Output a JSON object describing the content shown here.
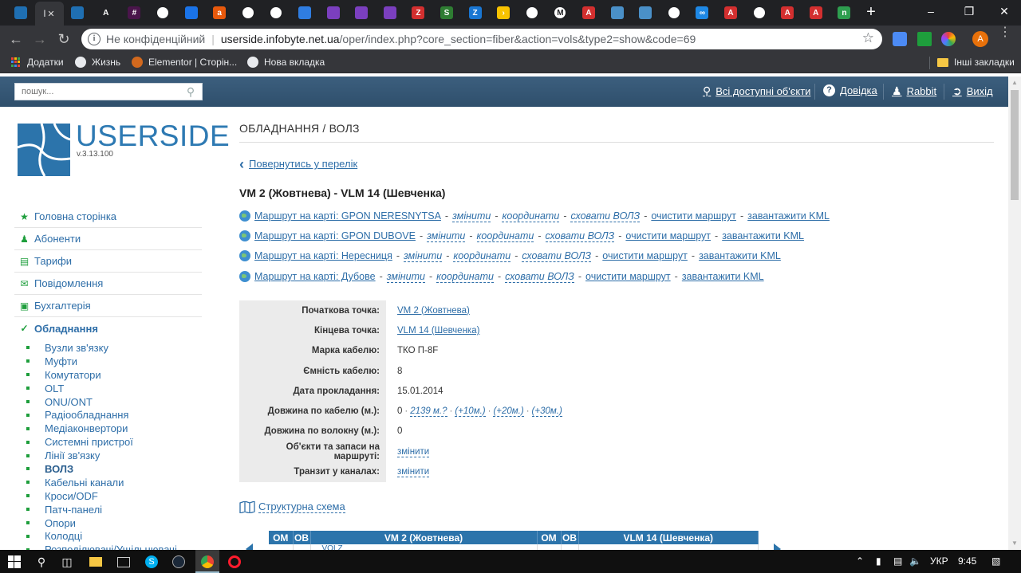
{
  "browser": {
    "tabs": [
      {
        "icon": "userside-favicon",
        "color": "#1f6fb2",
        "letter": ""
      },
      {
        "icon": "userside-favicon",
        "color": "#1f6fb2",
        "letter": ""
      },
      {
        "icon": "userside-favicon",
        "color": "#1f6fb2",
        "letter": ""
      },
      {
        "icon": "type-a-favicon",
        "color": "#202124",
        "letter": "A"
      },
      {
        "icon": "slack-favicon",
        "color": "#4a154b",
        "letter": "#"
      },
      {
        "icon": "square-favicon",
        "color": "#ffffff",
        "letter": ""
      },
      {
        "icon": "runner-favicon",
        "color": "#1a73e8",
        "letter": ""
      },
      {
        "icon": "orange-favicon",
        "color": "#e8590c",
        "letter": "a"
      },
      {
        "icon": "globe-favicon",
        "color": "#ffffff",
        "letter": ""
      },
      {
        "icon": "globe-favicon",
        "color": "#ffffff",
        "letter": ""
      },
      {
        "icon": "web-favicon",
        "color": "#2f7de1",
        "letter": ""
      },
      {
        "icon": "purple-favicon",
        "color": "#7b3fbf",
        "letter": ""
      },
      {
        "icon": "purple-favicon",
        "color": "#7b3fbf",
        "letter": ""
      },
      {
        "icon": "purple-favicon",
        "color": "#7b3fbf",
        "letter": ""
      },
      {
        "icon": "z-red-favicon",
        "color": "#d32f2f",
        "letter": "Z"
      },
      {
        "icon": "s-green-favicon",
        "color": "#2e7d32",
        "letter": "S"
      },
      {
        "icon": "z-blue-favicon",
        "color": "#1976d2",
        "letter": "Z"
      },
      {
        "icon": "arrow-yellow-favicon",
        "color": "#f9c300",
        "letter": "›"
      },
      {
        "icon": "circle-favicon",
        "color": "#ffffff",
        "letter": ""
      },
      {
        "icon": "gmail-favicon",
        "color": "#ffffff",
        "letter": "M"
      },
      {
        "icon": "a-red-favicon",
        "color": "#d32f2f",
        "letter": "A"
      },
      {
        "icon": "router-favicon",
        "color": "#4a90c8",
        "letter": ""
      },
      {
        "icon": "router-favicon",
        "color": "#4a90c8",
        "letter": ""
      },
      {
        "icon": "globe-favicon",
        "color": "#ffffff",
        "letter": ""
      },
      {
        "icon": "infinity-favicon",
        "color": "#1e88e5",
        "letter": "∞"
      },
      {
        "icon": "a-red-favicon",
        "color": "#d32f2f",
        "letter": "A"
      },
      {
        "icon": "doc-favicon",
        "color": "#ffffff",
        "letter": ""
      },
      {
        "icon": "a-red-favicon",
        "color": "#d32f2f",
        "letter": "A"
      },
      {
        "icon": "a-red-favicon",
        "color": "#d32f2f",
        "letter": "A"
      },
      {
        "icon": "n-green-favicon",
        "color": "#2e9e4f",
        "letter": "n"
      }
    ],
    "active_tab_label": "l",
    "address": {
      "security_label": "Не конфіденційний",
      "host": "userside.infobyte.net.ua",
      "path": "/oper/index.php?core_section=fiber&action=vols&type2=show&code=69"
    },
    "profile_letter": "A",
    "bookmarks": [
      {
        "label": "Додатки",
        "icon": "apps-icon"
      },
      {
        "label": "Жизнь",
        "icon": "globe-icon"
      },
      {
        "label": "Elementor | Сторін...",
        "icon": "elementor-icon"
      },
      {
        "label": "Нова вкладка",
        "icon": "globe-icon"
      }
    ],
    "other_bookmarks": "Інші закладки"
  },
  "header": {
    "search_placeholder": "пошук...",
    "links": {
      "all_objects": "Всі доступні об'єкти",
      "help": "Довідка",
      "user": "Rabbit",
      "logout": "Вихід"
    }
  },
  "sidebar": {
    "brand": "USERSIDE",
    "version": "v.3.13.100",
    "nav": [
      {
        "label": "Головна сторінка",
        "icon": "star-icon"
      },
      {
        "label": "Абоненти",
        "icon": "users-icon"
      },
      {
        "label": "Тарифи",
        "icon": "chart-icon"
      },
      {
        "label": "Повідомлення",
        "icon": "envelope-icon"
      },
      {
        "label": "Бухгалтерія",
        "icon": "money-icon"
      },
      {
        "label": "Обладнання",
        "icon": "wrench-icon"
      }
    ],
    "subnav": [
      "Вузли зв'язку",
      "Муфти",
      "Комутатори",
      "OLT",
      "ONU/ONT",
      "Радіообладнання",
      "Медіаконвертори",
      "Системні пристрої",
      "Лінії зв'язку",
      "ВОЛЗ",
      "Кабельні канали",
      "Кроси/ODF",
      "Патч-панелі",
      "Опори",
      "Колодці",
      "Розподілювачі/Ущільнювачі"
    ],
    "current_subitem": "ВОЛЗ"
  },
  "main": {
    "page_title": "ОБЛАДНАННЯ / ВОЛЗ",
    "back_link": "Повернутись у перелік",
    "route_title": "VM 2 (Жовтнева) - VLM 14 (Шевченка)",
    "map_routes": [
      {
        "label": "Маршрут на карті: GPON NERESNYTSA",
        "change": "змінити",
        "coords": "координати",
        "hide": "сховати ВОЛЗ",
        "clear": "очистити маршрут",
        "kml": "завантажити KML"
      },
      {
        "label": "Маршрут на карті: GPON DUBOVE",
        "change": "змінити",
        "coords": "координати",
        "hide": "сховати ВОЛЗ",
        "clear": "очистити маршрут",
        "kml": "завантажити KML"
      },
      {
        "label": "Маршрут на карті: Нересниця",
        "change": "змінити",
        "coords": "координати",
        "hide": "сховати ВОЛЗ",
        "clear": "очистити маршрут",
        "kml": "завантажити KML"
      },
      {
        "label": "Маршрут на карті: Дубове",
        "change": "змінити",
        "coords": "координати",
        "hide": "сховати ВОЛЗ",
        "clear": "очистити маршрут",
        "kml": "завантажити KML"
      }
    ],
    "info": {
      "start_label": "Початкова точка:",
      "start_value": "VM 2 (Жовтнева)",
      "end_label": "Кінцева точка:",
      "end_value": "VLM 14 (Шевченка)",
      "brand_label": "Марка кабелю:",
      "brand_value": "ТКО П-8F",
      "capacity_label": "Ємність кабелю:",
      "capacity_value": "8",
      "date_label": "Дата прокладання:",
      "date_value": "15.01.2014",
      "cable_len_label": "Довжина по кабелю (м.):",
      "cable_len_value": "0",
      "cable_len_calc": "2139 м.?",
      "plus10": "(+10м.)",
      "plus20": "(+20м.)",
      "plus30": "(+30м.)",
      "fiber_len_label": "Довжина по волокну (м.):",
      "fiber_len_value": "0",
      "objects_label": "Об'єкти та запаси на маршруті:",
      "objects_value": "змінити",
      "transit_label": "Транзит у каналах:",
      "transit_value": "змінити"
    },
    "schema_link": "Структурна схема",
    "fiber_table": {
      "headers": [
        "ОМ",
        "ОВ",
        "VM 2 (Жовтнева)",
        "ОМ",
        "ОВ",
        "VLM 14 (Шевченка)"
      ],
      "first_cell": "VOLZ"
    }
  },
  "taskbar": {
    "lang": "УКР",
    "time": "9:45"
  },
  "colors": {
    "accent_blue": "#2c74ab",
    "link": "#2e6ea8",
    "icon_green": "#1e9e3c",
    "header_bg": "#35536f"
  }
}
